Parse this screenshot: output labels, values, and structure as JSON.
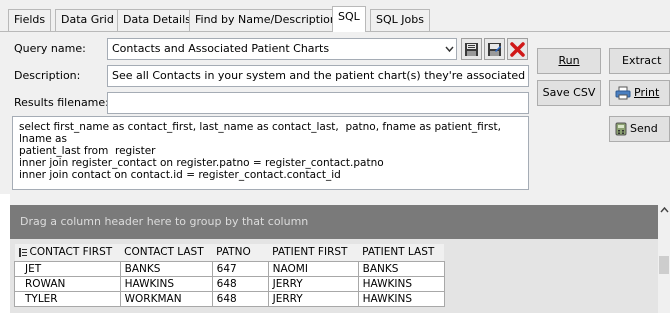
{
  "tabs": [
    {
      "label": "Fields"
    },
    {
      "label": "Data Grid"
    },
    {
      "label": "Data Details"
    },
    {
      "label": "Find by Name/Description"
    },
    {
      "label": "SQL"
    },
    {
      "label": "SQL Jobs"
    }
  ],
  "query_name": {
    "label": "Query name:",
    "value": "Contacts and Associated Patient Charts"
  },
  "description": {
    "label": "Description:",
    "value": "See all Contacts in your system and the patient chart(s) they're associated with.  T"
  },
  "results_filename": {
    "label": "Results filename:",
    "value": ""
  },
  "buttons": {
    "run": "Run",
    "extract": "Extract",
    "save_csv": "Save CSV",
    "print": "Print",
    "send": "Send"
  },
  "sql_text": "select first_name as contact_first, last_name as contact_last,  patno, fname as patient_first, lname as\npatient_last from  register\ninner join register_contact on register.patno = register_contact.patno\ninner join contact on contact.id = register_contact.contact_id",
  "grid": {
    "group_hint": "Drag a column header here to group by that column",
    "columns": [
      "CONTACT FIRST",
      "CONTACT LAST",
      "PATNO",
      "PATIENT FIRST",
      "PATIENT LAST"
    ],
    "rows": [
      [
        "JET",
        "BANKS",
        "647",
        "NAOMI",
        "BANKS"
      ],
      [
        "ROWAN",
        "HAWKINS",
        "648",
        "JERRY",
        "HAWKINS"
      ],
      [
        "TYLER",
        "WORKMAN",
        "648",
        "JERRY",
        "HAWKINS"
      ]
    ]
  },
  "colors": {
    "delete_icon": "#d01818",
    "group_panel": "#7a7a7a"
  }
}
